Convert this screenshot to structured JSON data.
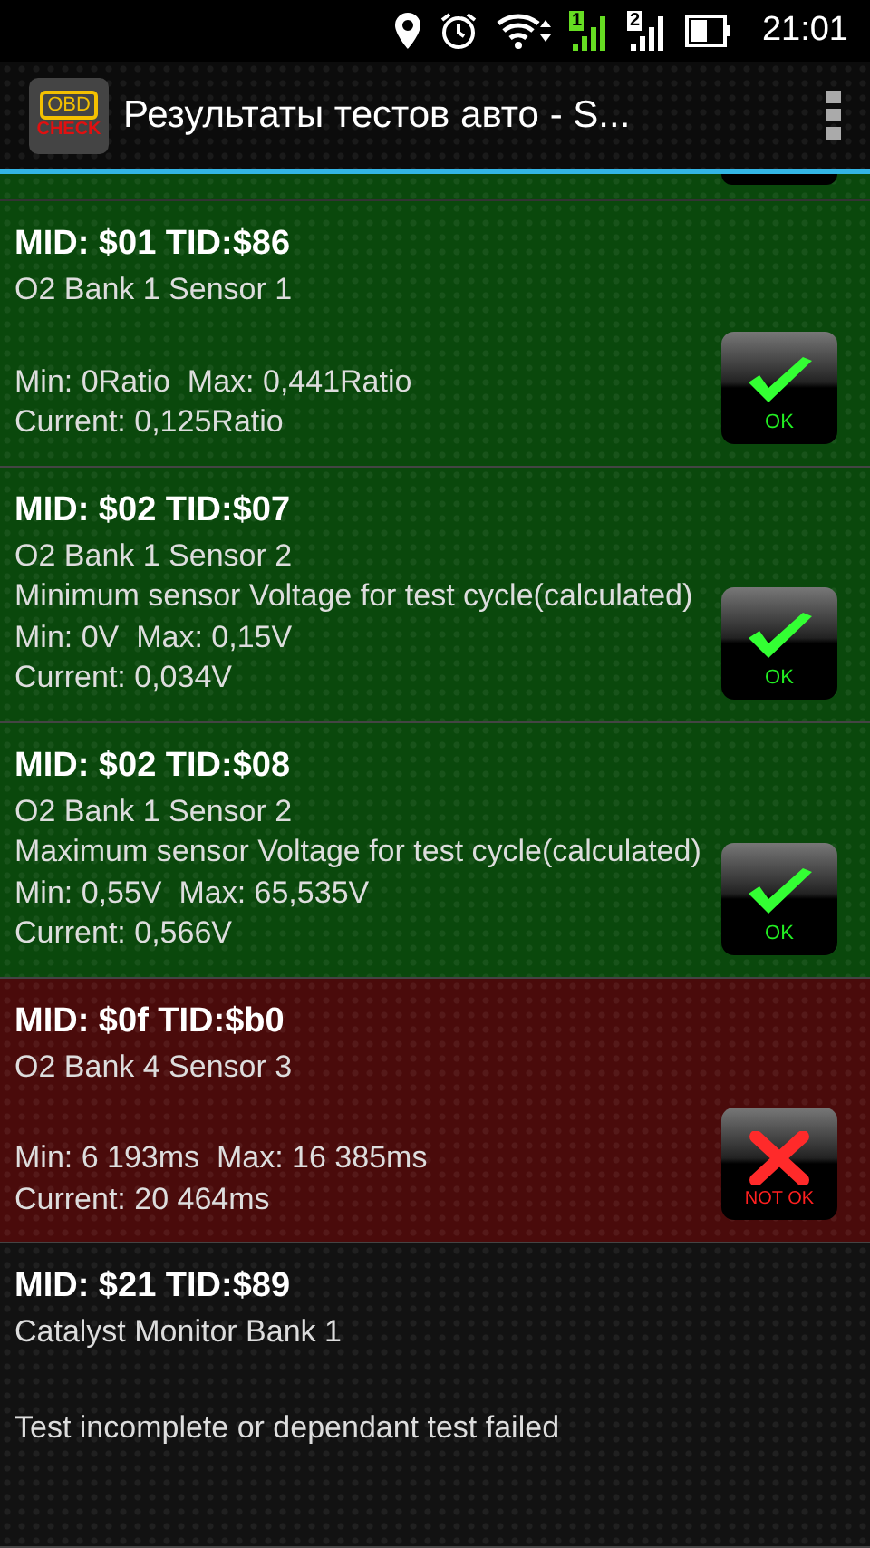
{
  "status_bar": {
    "time": "21:01",
    "sim_1": "1",
    "sim_2": "2"
  },
  "app_bar": {
    "title": "Результаты тестов авто - S...",
    "logo_top": "OBD",
    "logo_bottom": "CHECK"
  },
  "partial_row": {
    "kind": "ok"
  },
  "tests": [
    {
      "kind": "ok",
      "title": "MID: $01 TID:$86",
      "name": "O2 Bank 1 Sensor 1",
      "limits": "Min: 0Ratio  Max: 0,441Ratio",
      "current": "Current: 0,125Ratio",
      "badge": "OK"
    },
    {
      "kind": "ok",
      "title": "MID: $02 TID:$07",
      "name": "O2 Bank 1 Sensor 2",
      "description": "Minimum sensor Voltage for test cycle(calculated)",
      "limits": "Min: 0V  Max: 0,15V",
      "current": "Current: 0,034V",
      "badge": "OK"
    },
    {
      "kind": "ok",
      "title": "MID: $02 TID:$08",
      "name": "O2 Bank 1 Sensor 2",
      "description": "Maximum sensor Voltage for test cycle(calculated)",
      "limits": "Min: 0,55V  Max: 65,535V",
      "current": "Current: 0,566V",
      "badge": "OK"
    },
    {
      "kind": "fail",
      "title": "MID: $0f TID:$b0",
      "name": "O2 Bank 4 Sensor 3",
      "limits": "Min: 6 193ms  Max: 16 385ms",
      "current": "Current: 20 464ms",
      "badge": "NOT OK"
    },
    {
      "kind": "incomplete",
      "title": "MID: $21 TID:$89",
      "name": "Catalyst Monitor Bank 1",
      "message": "Test incomplete or dependant test failed"
    }
  ]
}
